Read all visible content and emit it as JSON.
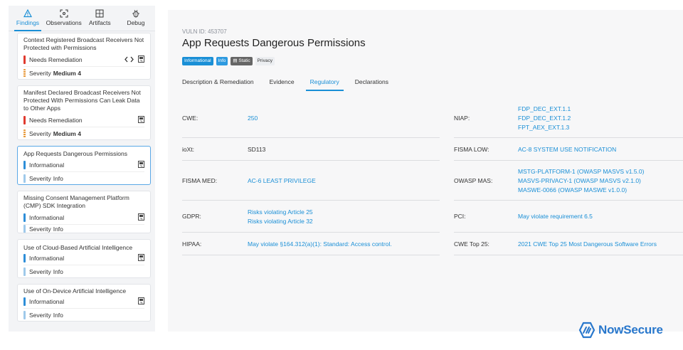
{
  "sidebar": {
    "tabs": [
      {
        "label": "Findings",
        "icon": "warning-triangle-icon",
        "active": true
      },
      {
        "label": "Observations",
        "icon": "scan-icon",
        "active": false
      },
      {
        "label": "Artifacts",
        "icon": "grid-box-icon",
        "active": false
      },
      {
        "label": "Debug",
        "icon": "bug-icon",
        "active": false
      }
    ],
    "cards": [
      {
        "title": "Context Registered Broadcast Receivers Not Protected with Permissions",
        "status": "Needs Remediation",
        "severity_label": "Severity",
        "severity": "Medium 4"
      },
      {
        "title": "Manifest Declared Broadcast Receivers Not Protected With Permissions Can Leak Data to Other Apps",
        "status": "Needs Remediation",
        "severity_label": "Severity",
        "severity": "Medium 4"
      },
      {
        "title": "App Requests Dangerous Permissions",
        "status": "Informational",
        "severity_label": "Severity",
        "severity": "Info"
      },
      {
        "title": "Missing Consent Management Platform (CMP) SDK Integration",
        "status": "Informational",
        "severity_label": "Severity",
        "severity": "Info"
      },
      {
        "title": "Use of Cloud-Based Artificial Intelligence",
        "status": "Informational",
        "severity_label": "Severity",
        "severity": "Info"
      },
      {
        "title": "Use of On-Device Artificial Intelligence",
        "status": "Informational",
        "severity_label": "Severity",
        "severity": "Info"
      }
    ]
  },
  "main": {
    "vuln_id": "VULN ID: 453707",
    "title": "App Requests Dangerous Permissions",
    "badges": [
      "Informational",
      "Info",
      "Static",
      "Privacy"
    ],
    "tabs": [
      "Description & Remediation",
      "Evidence",
      "Regulatory",
      "Declarations"
    ],
    "regulatory_left": [
      {
        "label": "CWE:",
        "values": [
          "250"
        ],
        "link": true
      },
      {
        "label": "ioXt:",
        "values": [
          "SD113"
        ],
        "link": false
      },
      {
        "label": "FISMA MED:",
        "values": [
          "AC-6 LEAST PRIVILEGE"
        ],
        "link": true
      },
      {
        "label": "GDPR:",
        "values": [
          "Risks violating Article 25",
          "Risks violating Article 32"
        ],
        "link": true
      },
      {
        "label": "HIPAA:",
        "values": [
          "May violate §164.312(a)(1): Standard: Access control."
        ],
        "link": true
      }
    ],
    "regulatory_right": [
      {
        "label": "NIAP:",
        "values": [
          "FDP_DEC_EXT.1.1",
          "FDP_DEC_EXT.1.2",
          "FPT_AEX_EXT.1.3"
        ],
        "link": true
      },
      {
        "label": "FISMA LOW:",
        "values": [
          "AC-8 SYSTEM USE NOTIFICATION"
        ],
        "link": true
      },
      {
        "label": "OWASP MAS:",
        "values": [
          "MSTG-PLATFORM-1 (OWASP MASVS v1.5.0)",
          "MASVS-PRIVACY-1 (OWASP MASVS v2.1.0)",
          "MASWE-0066 (OWASP MASWE v1.0.0)"
        ],
        "link": true
      },
      {
        "label": "PCI:",
        "values": [
          "May violate requirement 6.5"
        ],
        "link": true
      },
      {
        "label": "CWE Top 25:",
        "values": [
          "2021 CWE Top 25 Most Dangerous Software Errors"
        ],
        "link": true
      }
    ]
  },
  "logo": {
    "text": "NowSecure",
    "icon": "nowsecure-logo-icon"
  },
  "colors": {
    "accent": "#1a8fd6",
    "needs_remediation": "#e03a2f",
    "medium": "#e89a3c",
    "informational": "#2e8ed8",
    "logo": "#2877cc"
  }
}
